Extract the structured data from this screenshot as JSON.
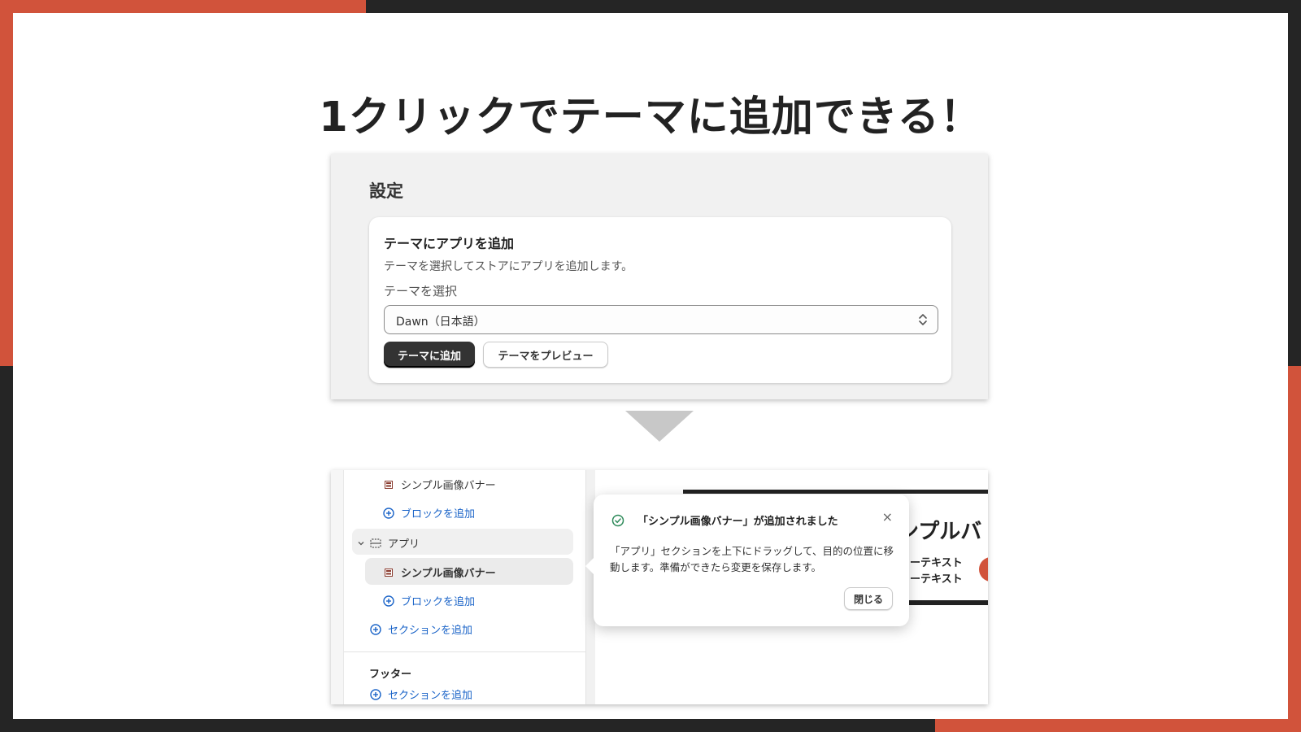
{
  "headline": "1クリックでテーマに追加できる！",
  "settings": {
    "title": "設定",
    "card": {
      "title": "テーマにアプリを追加",
      "description": "テーマを選択してストアにアプリを追加します。",
      "select_label": "テーマを選択",
      "select_value": "Dawn（日本語）",
      "add_button": "テーマに追加",
      "preview_button": "テーマをプレビュー"
    }
  },
  "editor": {
    "sidebar": {
      "items": [
        {
          "label": "シンプル画像バナー",
          "icon": "image-block-icon"
        },
        {
          "label": "ブロックを追加",
          "icon": "plus-circle-icon"
        },
        {
          "label": "アプリ",
          "icon": "section-icon"
        },
        {
          "label": "シンプル画像バナー",
          "icon": "image-block-icon"
        },
        {
          "label": "ブロックを追加",
          "icon": "plus-circle-icon"
        },
        {
          "label": "セクションを追加",
          "icon": "plus-circle-icon"
        }
      ],
      "footer_label": "フッター",
      "footer_add": "セクションを追加"
    },
    "preview": {
      "banner_title": "ンプルバ",
      "banner_line1": "ミーテキスト",
      "banner_line2": "ミーテキスト"
    },
    "toast": {
      "title": "「シンプル画像バナー」が追加されました",
      "body": "「アプリ」セクションを上下にドラッグして、目的の位置に移動します。準備ができたら変更を保存します。",
      "close_button": "閉じる"
    }
  },
  "colors": {
    "accent": "#d1533b",
    "dark": "#252525",
    "link": "#1b64c8",
    "success": "#2e8a5a"
  }
}
